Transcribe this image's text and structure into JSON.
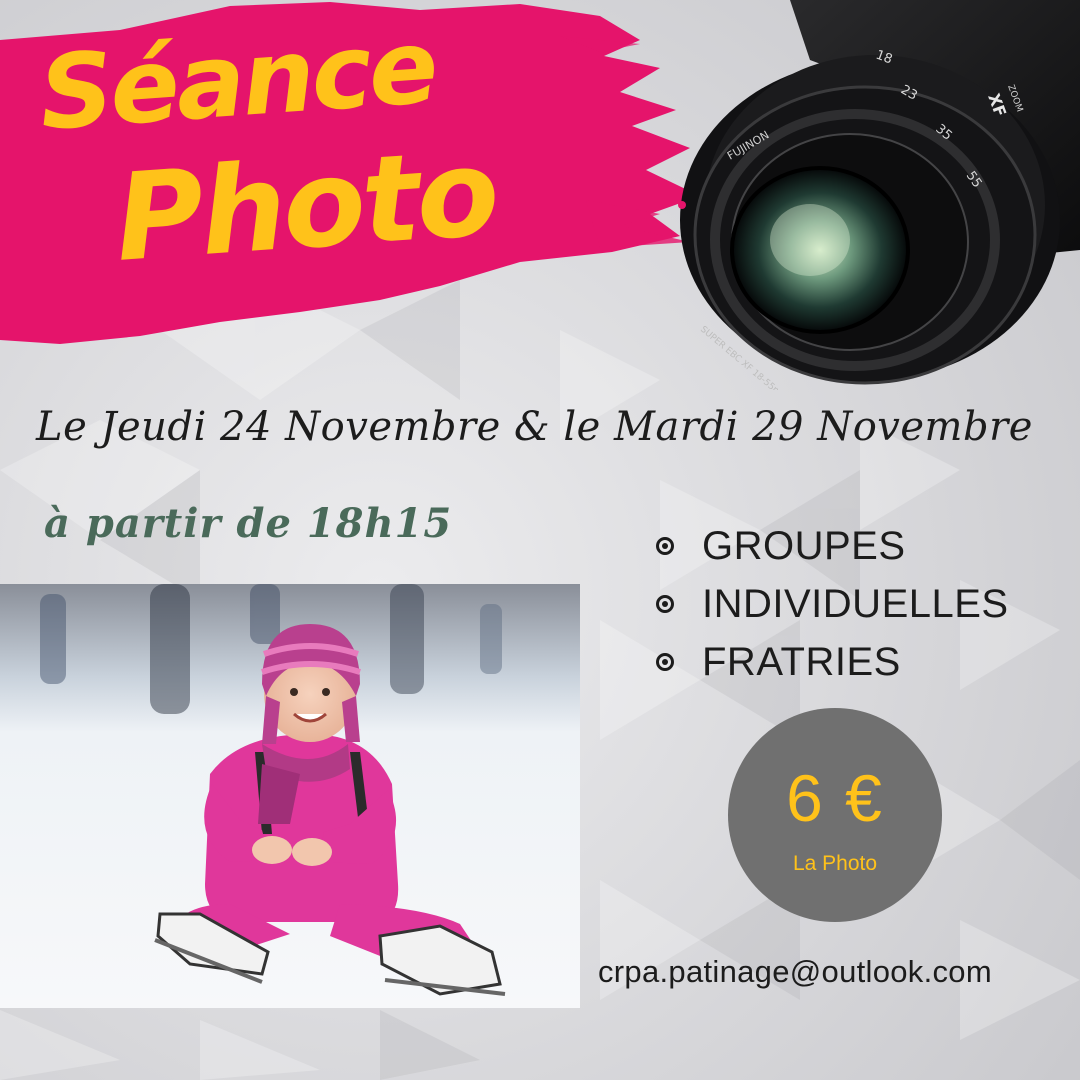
{
  "title": {
    "line1": "Séance",
    "line2": "Photo"
  },
  "dates": "Le Jeudi 24 Novembre & le Mardi 29 Novembre",
  "time": "à partir de 18h15",
  "options": [
    {
      "label": "GROUPES"
    },
    {
      "label": "INDIVIDUELLES"
    },
    {
      "label": "FRATRIES"
    }
  ],
  "price": {
    "amount": "6 €",
    "label": "La Photo"
  },
  "email": "crpa.patinage@outlook.com",
  "camera": {
    "brand": "FUJINON",
    "lens_text": "SUPER EBC XF 18-55mm 1:2.8-4 R LM OIS Ø58",
    "zoom_marks": [
      "18",
      "23",
      "35",
      "55"
    ],
    "mount_label": "XF",
    "zoom_label": "ZOOM"
  },
  "colors": {
    "accent_pink": "#e5146b",
    "title_yellow": "#ffc21a",
    "time_green": "#4a6a5a",
    "background_grey": "#d9d9dc",
    "badge_grey": "#707070"
  }
}
